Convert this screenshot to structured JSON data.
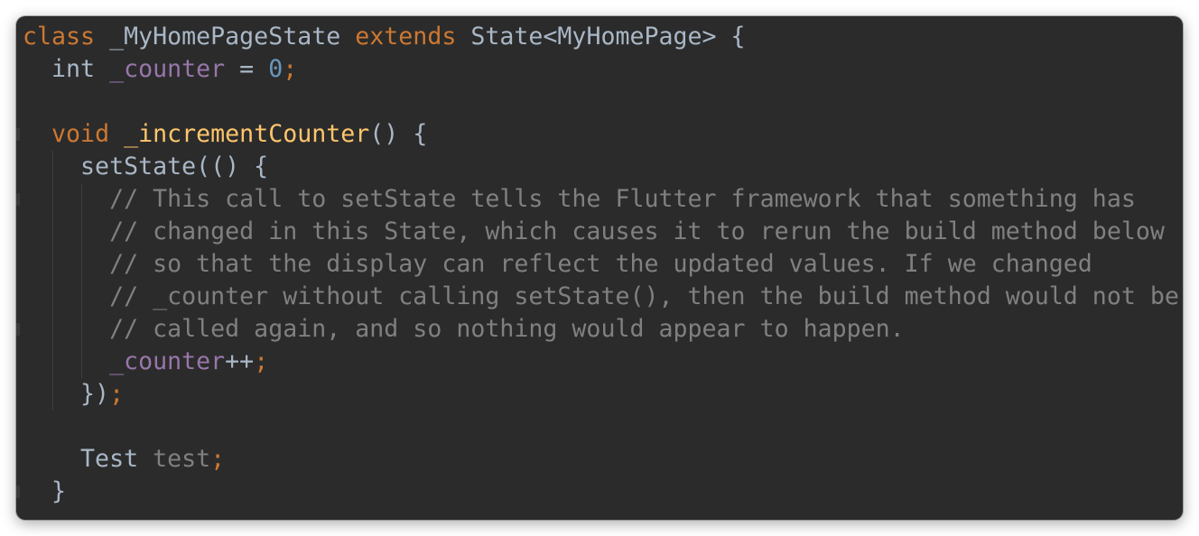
{
  "editor": {
    "language": "Dart",
    "theme_colors": {
      "background": "#2b2b2b",
      "keyword": "#cc7832",
      "default_text": "#a9b7c6",
      "field": "#9876aa",
      "number": "#6897bb",
      "function_declaration": "#ffc66d",
      "comment": "#808080"
    },
    "lines": [
      [
        {
          "t": "class",
          "k": "kw"
        },
        {
          "t": " _MyHomePageState ",
          "k": "cls"
        },
        {
          "t": "extends",
          "k": "kw"
        },
        {
          "t": " State<MyHomePage> {",
          "k": "cls"
        }
      ],
      [
        {
          "t": "  int ",
          "k": "cls"
        },
        {
          "t": "_counter",
          "k": "field"
        },
        {
          "t": " = ",
          "k": "punct"
        },
        {
          "t": "0",
          "k": "num"
        },
        {
          "t": ";",
          "k": "semi"
        }
      ],
      [],
      [
        {
          "t": "  ",
          "k": "punct"
        },
        {
          "t": "void",
          "k": "kw"
        },
        {
          "t": " ",
          "k": "punct"
        },
        {
          "t": "_incrementCounter",
          "k": "fn"
        },
        {
          "t": "() {",
          "k": "punct"
        }
      ],
      [
        {
          "t": "    setState(() {",
          "k": "punct"
        }
      ],
      [
        {
          "t": "      ",
          "k": "punct"
        },
        {
          "t": "// This call to setState tells the Flutter framework that something has",
          "k": "comment"
        }
      ],
      [
        {
          "t": "      ",
          "k": "punct"
        },
        {
          "t": "// changed in this State, which causes it to rerun the build method below",
          "k": "comment"
        }
      ],
      [
        {
          "t": "      ",
          "k": "punct"
        },
        {
          "t": "// so that the display can reflect the updated values. If we changed",
          "k": "comment"
        }
      ],
      [
        {
          "t": "      ",
          "k": "punct"
        },
        {
          "t": "// _counter without calling setState(), then the build method would not be",
          "k": "comment"
        }
      ],
      [
        {
          "t": "      ",
          "k": "punct"
        },
        {
          "t": "// called again, and so nothing would appear to happen.",
          "k": "comment"
        }
      ],
      [
        {
          "t": "      ",
          "k": "punct"
        },
        {
          "t": "_counter",
          "k": "field"
        },
        {
          "t": "++",
          "k": "punct"
        },
        {
          "t": ";",
          "k": "semi"
        }
      ],
      [
        {
          "t": "    })",
          "k": "punct"
        },
        {
          "t": ";",
          "k": "semi"
        }
      ],
      [],
      [
        {
          "t": "    Test ",
          "k": "cls"
        },
        {
          "t": "test",
          "k": "unused"
        },
        {
          "t": ";",
          "k": "semi"
        }
      ],
      [
        {
          "t": "  }",
          "k": "punct"
        }
      ]
    ]
  }
}
